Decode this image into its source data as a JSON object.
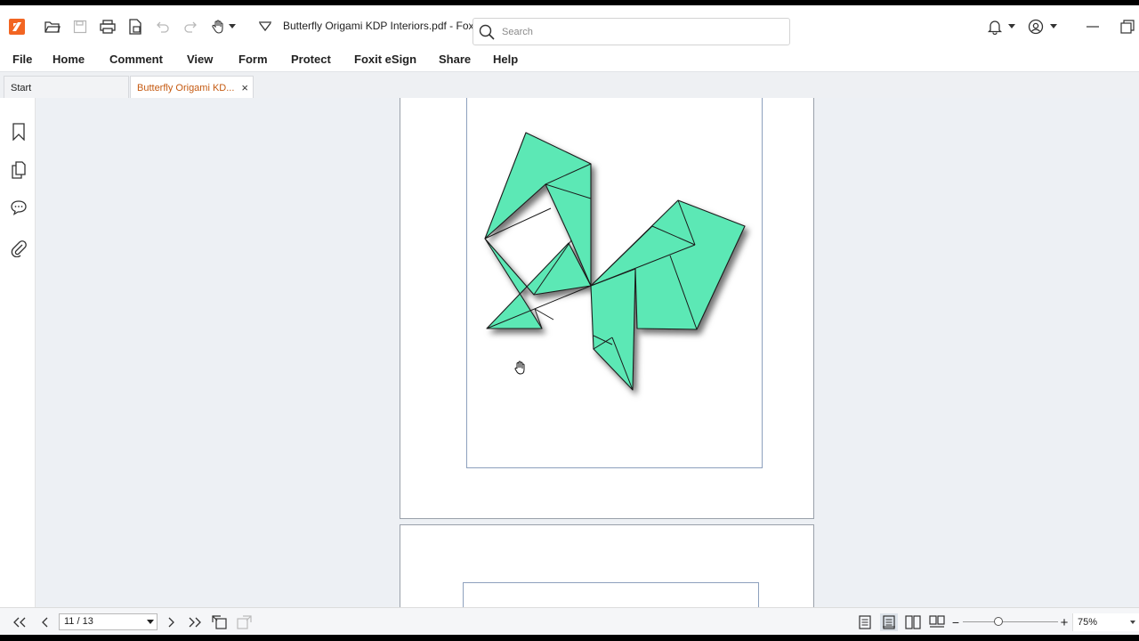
{
  "app": {
    "document_title": "Butterfly Origami KDP Interiors.pdf - Fox...",
    "brand_color": "#f26522",
    "accent_color": "#c55a11"
  },
  "toolbar": {
    "icons": [
      "foxit-logo-icon",
      "open-folder-icon",
      "save-icon",
      "print-icon",
      "create-pdf-icon",
      "undo-icon",
      "redo-icon",
      "hand-tool-icon",
      "customize-quick-access-icon"
    ]
  },
  "search": {
    "placeholder": "Search",
    "value": ""
  },
  "menu": {
    "items": [
      "File",
      "Home",
      "Comment",
      "View",
      "Form",
      "Protect",
      "Foxit eSign",
      "Share",
      "Help"
    ]
  },
  "tabs": [
    {
      "label": "Start",
      "active": false
    },
    {
      "label": "Butterfly Origami KD...",
      "active": true,
      "close": "×"
    }
  ],
  "sidebar": {
    "icons": [
      "bookmark-icon",
      "pages-icon",
      "comments-icon",
      "attachments-icon"
    ]
  },
  "document": {
    "current_page": 11,
    "total_pages": 13,
    "butterfly_color": "#5ce8b5"
  },
  "statusbar": {
    "page_indicator": "11 / 13",
    "zoom": "75%",
    "zoom_fraction": 0.37,
    "zoom_minus": "−",
    "zoom_plus": "+"
  }
}
